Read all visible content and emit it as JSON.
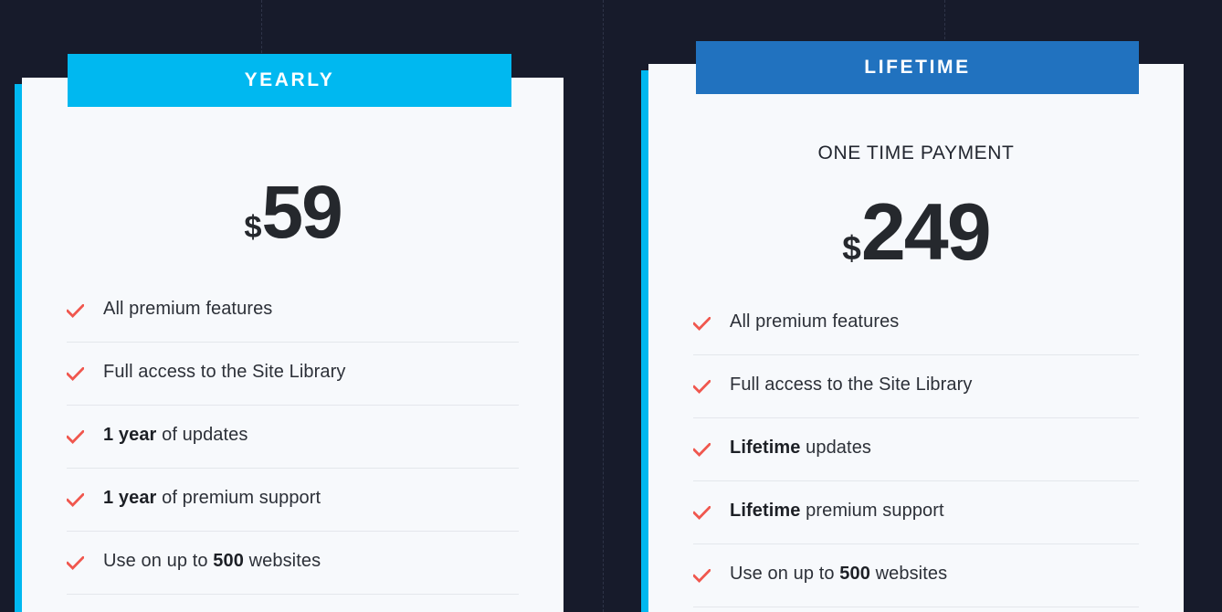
{
  "theme": {
    "background": "#171b2b",
    "card_background": "#f7f9fc",
    "accent_cyan": "#00b8f0",
    "accent_blue": "#2172bf",
    "check_red": "#f0574e",
    "text_dark": "#2c3038",
    "divider": "#e4e7ec"
  },
  "plans": [
    {
      "id": "yearly",
      "header_label": "YEARLY",
      "subtitle": "",
      "currency_symbol": "$",
      "price": "59",
      "features": [
        {
          "prefix": "",
          "bold": "",
          "text": "All premium features"
        },
        {
          "prefix": "",
          "bold": "",
          "text": "Full access to the Site Library"
        },
        {
          "prefix": "",
          "bold": "1 year",
          "text": " of updates"
        },
        {
          "prefix": "",
          "bold": "1 year",
          "text": " of premium support"
        },
        {
          "prefix": "Use on up to ",
          "bold": "500",
          "text": " websites"
        }
      ]
    },
    {
      "id": "lifetime",
      "header_label": "LIFETIME",
      "subtitle": "ONE TIME PAYMENT",
      "currency_symbol": "$",
      "price": "249",
      "features": [
        {
          "prefix": "",
          "bold": "",
          "text": "All premium features"
        },
        {
          "prefix": "",
          "bold": "",
          "text": "Full access to the Site Library"
        },
        {
          "prefix": "",
          "bold": "Lifetime",
          "text": " updates"
        },
        {
          "prefix": "",
          "bold": "Lifetime",
          "text": " premium support"
        },
        {
          "prefix": "Use on up to ",
          "bold": "500",
          "text": " websites"
        }
      ]
    }
  ]
}
